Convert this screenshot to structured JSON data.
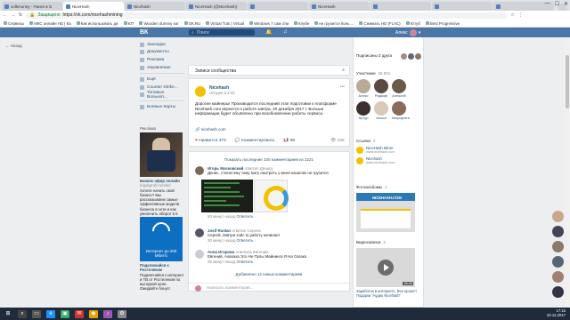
{
  "browser": {
    "tabs": [
      {
        "label": "volkmoney - Поиск в G",
        "active": false
      },
      {
        "label": "NiceHash",
        "active": true
      },
      {
        "label": "Nicehash",
        "active": false
      },
      {
        "label": "NiceHash (@Nicehash)",
        "active": false
      },
      {
        "label": "",
        "active": false
      },
      {
        "label": "NiceHash",
        "active": false
      },
      {
        "label": "",
        "active": false
      },
      {
        "label": "",
        "active": false
      },
      {
        "label": "",
        "active": false
      }
    ],
    "window_controls": [
      "—",
      "☐",
      "✕"
    ],
    "secure_label": "Защищено",
    "url": "https://vk.com/nicehashmining",
    "bookmarks": [
      "Сервисы",
      "МКС онлайн HD | Ка",
      "Как использовать ди",
      "ЮТ",
      "Wooden dummy sor",
      "ОК.RU",
      "Virtual Tuts | Virtual",
      "Windows 7 сам отм",
      "Клубе",
      "не грузится боль ...",
      "Сжимать HD (FLAC)",
      "Ютуб",
      "Best Progressive"
    ]
  },
  "vk": {
    "logo": "ВК",
    "search_placeholder": "Поиск",
    "user": "Алекс",
    "back_label": "Назад",
    "menu": [
      "Закладки",
      "Документы",
      "Реклама",
      "Управление",
      "Ещё",
      "Counter Strike...",
      "Топовые Вольноп...",
      "Боевые Карты"
    ],
    "ads_header": "Реклама",
    "ad1": {
      "title": "Бизнес-эфир онлайн",
      "sub": "trigubprofi.ru/mlm/",
      "text": "Хотите начать свой бизнес? Мы рассказываем самые эффективные модели бизнеса в сети и как увеличить оборот в 5 раз!"
    },
    "ad2": {
      "img_text": "Интернет до 200 Мбит/с",
      "title": "Подключайся к Ростелеком",
      "text": "Подключайся к интернет и ТВ от Ростелеком по выгодной цене. Ожидайте бонус!"
    }
  },
  "wall": {
    "header": "Записи сообщества",
    "post": {
      "author": "Nicehash",
      "date": "сегодня в 3:22",
      "text": "Дорогие майнеры! Производится последний этап подготовки к платформе Nicehash.com вернется к работе завтра, 20 декабря 2017 г. Больше информации будет объявлено при возобновлении работы сервиса.",
      "link": "nicehash.com",
      "likes_label": "Нравится",
      "likes": "373",
      "comments_label": "Комментировать",
      "reposts": "98",
      "views": "16K"
    },
    "show_more": "Показать последние 100 комментариев из 2221",
    "comments": [
      {
        "name": "Игорь Московский",
        "reply_to": "ответил Денису",
        "text": "Денис, статистику тому могу смотреть у меня кошелек не грузится",
        "meta": "50 минут назад",
        "reply": "Ответить"
      },
      {
        "name": "Josif Ruslan",
        "reply_to": "ответил Сергею",
        "text": "Сергей, Завтра хэйс to работу начинает",
        "meta": "30 минут назад",
        "reply": "Ответить"
      },
      {
        "name": "Анна Игорова",
        "reply_to": "ответила Евгению",
        "text": "Евгений, Ахахаха Это Не Пулы Майнинга Я На Сказка",
        "meta": "35 минут назад",
        "reply": "Ответить"
      }
    ],
    "more_replies": "Добавлено 12 новых комментариев",
    "comment_placeholder": "Написать комментарий..."
  },
  "right": {
    "subs": {
      "label": "Подписаны 3 друга"
    },
    "members": {
      "label": "Участники",
      "count": "26 001",
      "names": [
        "Алекс",
        "Радмир",
        "Алексей",
        "Артур",
        "Алиса",
        "Маргарита"
      ]
    },
    "links": {
      "label": "Ссылки",
      "count": "2",
      "items": [
        {
          "title": "NiceHash Miner",
          "url": "www.nicehash.com"
        },
        {
          "title": "Nicehash",
          "url": "www.nicehash.com"
        }
      ]
    },
    "photos": {
      "label": "Фотоальбомы",
      "count": "1",
      "img_text": "NICEHASH.COM"
    },
    "videos": {
      "label": "Видеозаписи",
      "count": "2",
      "title": "Заработок в интернете. Все проект! Подарки \"Аудио Nicehash\"",
      "duration": "26:40"
    }
  },
  "taskbar": {
    "icons": [
      "⊞",
      "⌕",
      "▭",
      "e",
      "▣",
      "✉",
      "◉",
      "♪",
      "⚙"
    ],
    "time": "17:15",
    "date": "20.12.2017"
  },
  "colors": {
    "vk_blue": "#4a76a8",
    "link": "#285473",
    "bg": "#edeef0"
  }
}
